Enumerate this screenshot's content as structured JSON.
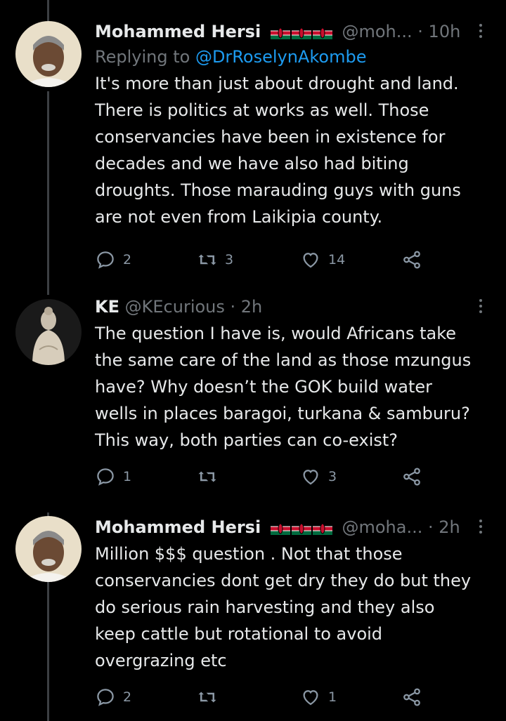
{
  "tweets": [
    {
      "name": "Mohammed Hersi",
      "handle": "@moh...",
      "time": "· 10h",
      "replying_prefix": "Replying to",
      "replying_to": "@DrRoselynAkombe",
      "text": "It's more than just about drought and land.\nThere is politics at works as well. Those\nconservancies have been in existence for\ndecades and we have also had biting\ndroughts. Those marauding guys with guns\nare not even from Laikipia county.",
      "replies": "2",
      "retweets": "3",
      "likes": "14"
    },
    {
      "name": "KE",
      "handle": "@KEcurious",
      "time": "· 2h",
      "text": "The question I have is, would Africans take\nthe same care of the land as those mzungus\nhave? Why doesn’t the GOK build water\nwells in places baragoi, turkana & samburu?\nThis way, both parties can co-exist?",
      "replies": "1",
      "retweets": "",
      "likes": "3"
    },
    {
      "name": "Mohammed Hersi",
      "handle": "@moha...",
      "time": "· 2h",
      "text": "Million $$$ question . Not that those\nconservancies  dont get dry they do but they\ndo serious rain harvesting and they also\nkeep cattle  but rotational to avoid\novergrazing etc",
      "replies": "2",
      "retweets": "",
      "likes": "1"
    }
  ],
  "icons": {
    "reply": "reply-icon",
    "retweet": "retweet-icon",
    "like": "like-icon",
    "share": "share-icon",
    "more": "more-icon",
    "flag": "kenya-flag-icon"
  },
  "colors": {
    "background": "#000000",
    "text": "#e7e9ea",
    "muted": "#71767b",
    "link": "#1d9bf0"
  }
}
